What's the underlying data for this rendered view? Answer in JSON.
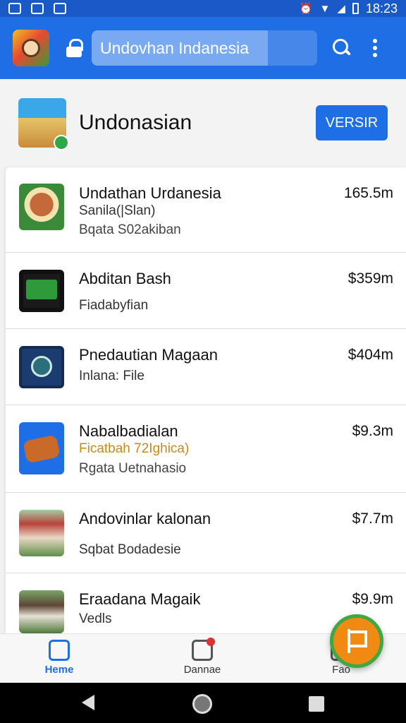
{
  "status_bar": {
    "time": "18:23"
  },
  "app_bar": {
    "search_value": "Undovhan Indanesia"
  },
  "header": {
    "title": "Undonasian",
    "button_label": "VERSIR"
  },
  "list": [
    {
      "title": "Undathan Urdanesia",
      "price": "165.5m",
      "sub": "Sanila(|Slan)",
      "sub2": "Bqata S02akiban",
      "icon_color": "#3a8a3a"
    },
    {
      "title": "Abditan Bash",
      "price": "$359m",
      "sub": "Fiadabyfian",
      "sub2": "",
      "icon_color": "#1a1a1a"
    },
    {
      "title": "Pnedautian Magaan",
      "price": "$404m",
      "sub": "Inlana: File",
      "sub2": "",
      "icon_color": "#1b3c6e"
    },
    {
      "title": "Nabalbadialan",
      "price": "$9.3m",
      "sub": "Ficatbah 72Ighica)",
      "sub2": "Rgata Uetnahasio",
      "icon_color": "#1e6ee6"
    },
    {
      "title": "Andovinlar kalonan",
      "price": "$7.7m",
      "sub": "Sqbat Bodadesie",
      "sub2": "",
      "icon_color": "#b9433b"
    },
    {
      "title": "Eraadana Magaik",
      "price": "$9.9m",
      "sub": "Vedls",
      "sub2": "",
      "icon_color": "#6b8e4e"
    }
  ],
  "bottom_nav": [
    {
      "label": "Heme"
    },
    {
      "label": "Dannae"
    },
    {
      "label": "Fao"
    }
  ],
  "icons": {
    "app_logo": "app-logo-icon",
    "lock": "lock-icon",
    "search": "search-icon",
    "more": "more-vert-icon",
    "fab": "flag-icon"
  }
}
